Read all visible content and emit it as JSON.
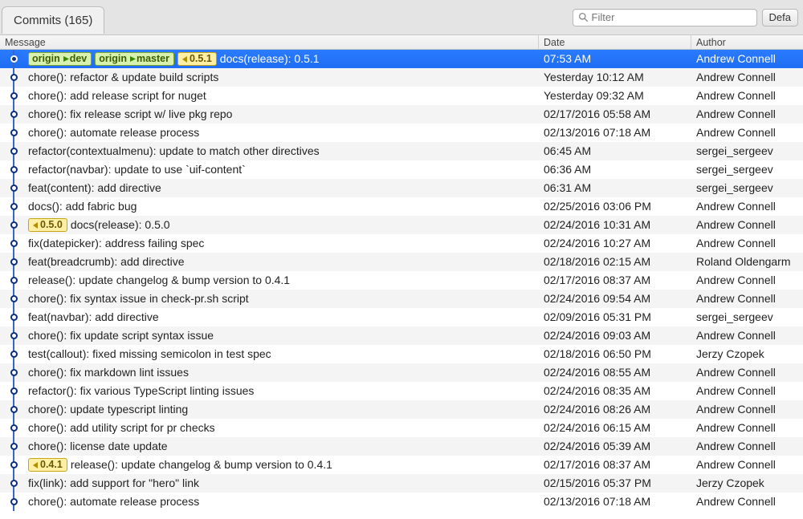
{
  "header": {
    "tab_label": "Commits (165)",
    "filter_placeholder": "Filter",
    "default_button": "Defa"
  },
  "columns": {
    "message": "Message",
    "date": "Date",
    "author": "Author"
  },
  "commits": [
    {
      "selected": true,
      "badges": [
        {
          "type": "green",
          "arrow": "right",
          "left": "origin",
          "right": "dev"
        },
        {
          "type": "green",
          "arrow": "right",
          "left": "origin",
          "right": "master"
        },
        {
          "type": "yellow",
          "arrow": "left",
          "text": "0.5.1"
        }
      ],
      "message": "docs(release): 0.5.1",
      "date": "07:53 AM",
      "author": "Andrew Connell"
    },
    {
      "message": "chore(): refactor & update build scripts",
      "date": "Yesterday 10:12 AM",
      "author": "Andrew Connell"
    },
    {
      "message": "chore(): add release script for nuget",
      "date": "Yesterday 09:32 AM",
      "author": "Andrew Connell"
    },
    {
      "message": "chore(): fix release script w/ live pkg repo",
      "date": "02/17/2016 05:58 AM",
      "author": "Andrew Connell"
    },
    {
      "message": "chore(): automate release process",
      "date": "02/13/2016 07:18 AM",
      "author": "Andrew Connell"
    },
    {
      "message": "refactor(contextualmenu): update to match other directives",
      "date": "06:45 AM",
      "author": "sergei_sergeev"
    },
    {
      "message": "refactor(navbar): update to use `uif-content`",
      "date": "06:36 AM",
      "author": "sergei_sergeev"
    },
    {
      "message": "feat(content): add directive",
      "date": "06:31 AM",
      "author": "sergei_sergeev"
    },
    {
      "message": "docs(): add fabric bug",
      "date": "02/25/2016 03:06 PM",
      "author": "Andrew Connell"
    },
    {
      "badges": [
        {
          "type": "yellow",
          "arrow": "left",
          "text": "0.5.0"
        }
      ],
      "message": "docs(release): 0.5.0",
      "date": "02/24/2016 10:31 AM",
      "author": "Andrew Connell"
    },
    {
      "message": "fix(datepicker): address failing spec",
      "date": "02/24/2016 10:27 AM",
      "author": "Andrew Connell"
    },
    {
      "message": "feat(breadcrumb): add directive",
      "date": "02/18/2016 02:15 AM",
      "author": "Roland Oldengarm"
    },
    {
      "message": "release(): update changelog & bump version to 0.4.1",
      "date": "02/17/2016 08:37 AM",
      "author": "Andrew Connell"
    },
    {
      "message": "chore(): fix syntax issue in check-pr.sh script",
      "date": "02/24/2016 09:54 AM",
      "author": "Andrew Connell"
    },
    {
      "message": "feat(navbar): add directive",
      "date": "02/09/2016 05:31 PM",
      "author": "sergei_sergeev"
    },
    {
      "message": "chore(): fix update script syntax issue",
      "date": "02/24/2016 09:03 AM",
      "author": "Andrew Connell"
    },
    {
      "message": "test(callout): fixed missing semicolon in test spec",
      "date": "02/18/2016 06:50 PM",
      "author": "Jerzy Czopek"
    },
    {
      "message": "chore(): fix markdown lint issues",
      "date": "02/24/2016 08:55 AM",
      "author": "Andrew Connell"
    },
    {
      "message": "refactor(): fix various TypeScript linting issues",
      "date": "02/24/2016 08:35 AM",
      "author": "Andrew Connell"
    },
    {
      "message": "chore(): update typescript linting",
      "date": "02/24/2016 08:26 AM",
      "author": "Andrew Connell"
    },
    {
      "message": "chore(): add utility script for pr checks",
      "date": "02/24/2016 06:15 AM",
      "author": "Andrew Connell"
    },
    {
      "message": "chore(): license date update",
      "date": "02/24/2016 05:39 AM",
      "author": "Andrew Connell"
    },
    {
      "badges": [
        {
          "type": "yellow",
          "arrow": "left",
          "text": "0.4.1"
        }
      ],
      "message": "release(): update changelog & bump version to 0.4.1",
      "date": "02/17/2016 08:37 AM",
      "author": "Andrew Connell"
    },
    {
      "message": "fix(link): add support for \"hero\" link",
      "date": "02/15/2016 05:37 PM",
      "author": "Jerzy Czopek"
    },
    {
      "message": "chore(): automate release process",
      "date": "02/13/2016 07:18 AM",
      "author": "Andrew Connell"
    }
  ]
}
